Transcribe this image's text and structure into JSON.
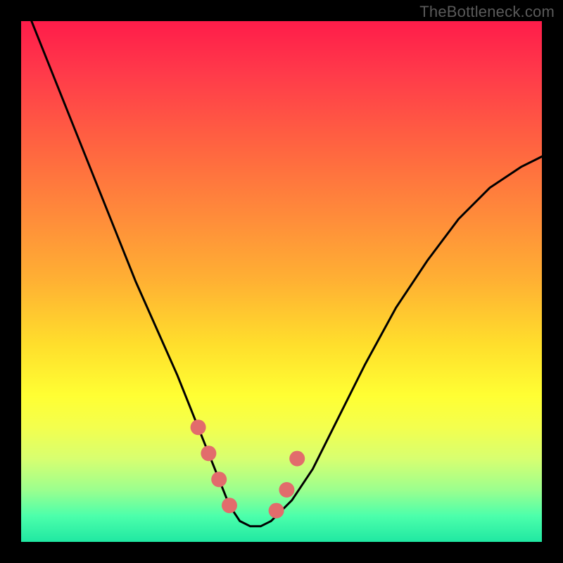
{
  "watermark": "TheBottleneck.com",
  "chart_data": {
    "type": "line",
    "title": "",
    "xlabel": "",
    "ylabel": "",
    "xlim": [
      0,
      100
    ],
    "ylim": [
      0,
      100
    ],
    "series": [
      {
        "name": "bottleneck-curve",
        "x": [
          2,
          6,
          10,
          14,
          18,
          22,
          26,
          30,
          34,
          36,
          38,
          40,
          42,
          44,
          46,
          48,
          52,
          56,
          60,
          66,
          72,
          78,
          84,
          90,
          96,
          100
        ],
        "values": [
          100,
          90,
          80,
          70,
          60,
          50,
          41,
          32,
          22,
          17,
          12,
          7,
          4,
          3,
          3,
          4,
          8,
          14,
          22,
          34,
          45,
          54,
          62,
          68,
          72,
          74
        ]
      }
    ],
    "markers": {
      "name": "highlight-dots",
      "color": "#e26c6c",
      "x": [
        34,
        36,
        38,
        40,
        49,
        51,
        53
      ],
      "values": [
        22,
        17,
        12,
        7,
        6,
        10,
        16
      ]
    },
    "background_gradient": {
      "top": "#ff1c4a",
      "mid": "#ffde2c",
      "bottom": "#20e8a2"
    }
  }
}
